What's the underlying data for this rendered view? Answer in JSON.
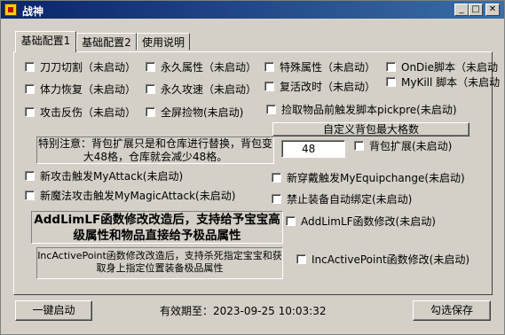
{
  "window": {
    "title": "战神"
  },
  "titlebar_buttons": {
    "minimize": "_",
    "maximize": "□",
    "close": "✕"
  },
  "tabs": [
    {
      "label": "基础配置1",
      "active": true
    },
    {
      "label": "基础配置2",
      "active": false
    },
    {
      "label": "使用说明",
      "active": false
    }
  ],
  "checkboxes": {
    "r1": [
      "刀刀切割（未启动）",
      "永久属性（未启动）",
      "特殊属性（未启动）",
      "OnDie脚本（未启动"
    ],
    "r2": [
      "体力恢复（未启动）",
      "永久攻速（未启动）",
      "复活改时（未启动）",
      "MyKill 脚本（未启动"
    ],
    "r3": [
      "攻击反伤（未启动）",
      "全屏捡物(未启动)",
      "捡取物品前触发脚本pickpre(未启动)"
    ],
    "bag_expand": "背包扩展(未启动)",
    "my_attack": "新攻击触发MyAttack(未启动)",
    "my_equipchange": "新穿戴触发MyEquipchange(未启动)",
    "my_magic_attack": "新魔法攻击触发MyMagicAttack(未启动)",
    "bind_equip": "禁止装备自动绑定(未启动)",
    "addlimlf": "AddLimLF函数修改(未启动)",
    "incactivepoint": "IncActivePoint函数修改(未启动)"
  },
  "buttons": {
    "custom_bag": "自定义背包最大格数",
    "one_click_start": "一键启动",
    "save": "勾选保存"
  },
  "note_text": "特别注意：背包扩展只是和仓库进行替换，背包变大48格，仓库就会减少48格。",
  "bag_value": "48",
  "addlimlf_note": "AddLimLF函数修改改造后，支持给予宝宝高级属性和物品直接给予极品属性",
  "incactive_note": "IncActivePoint函数修改改造后，支持杀死指定宝宝和获取身上指定位置装备极品属性",
  "status": {
    "label": "有效期至：",
    "datetime": "2023-09-25 10:03:32"
  }
}
